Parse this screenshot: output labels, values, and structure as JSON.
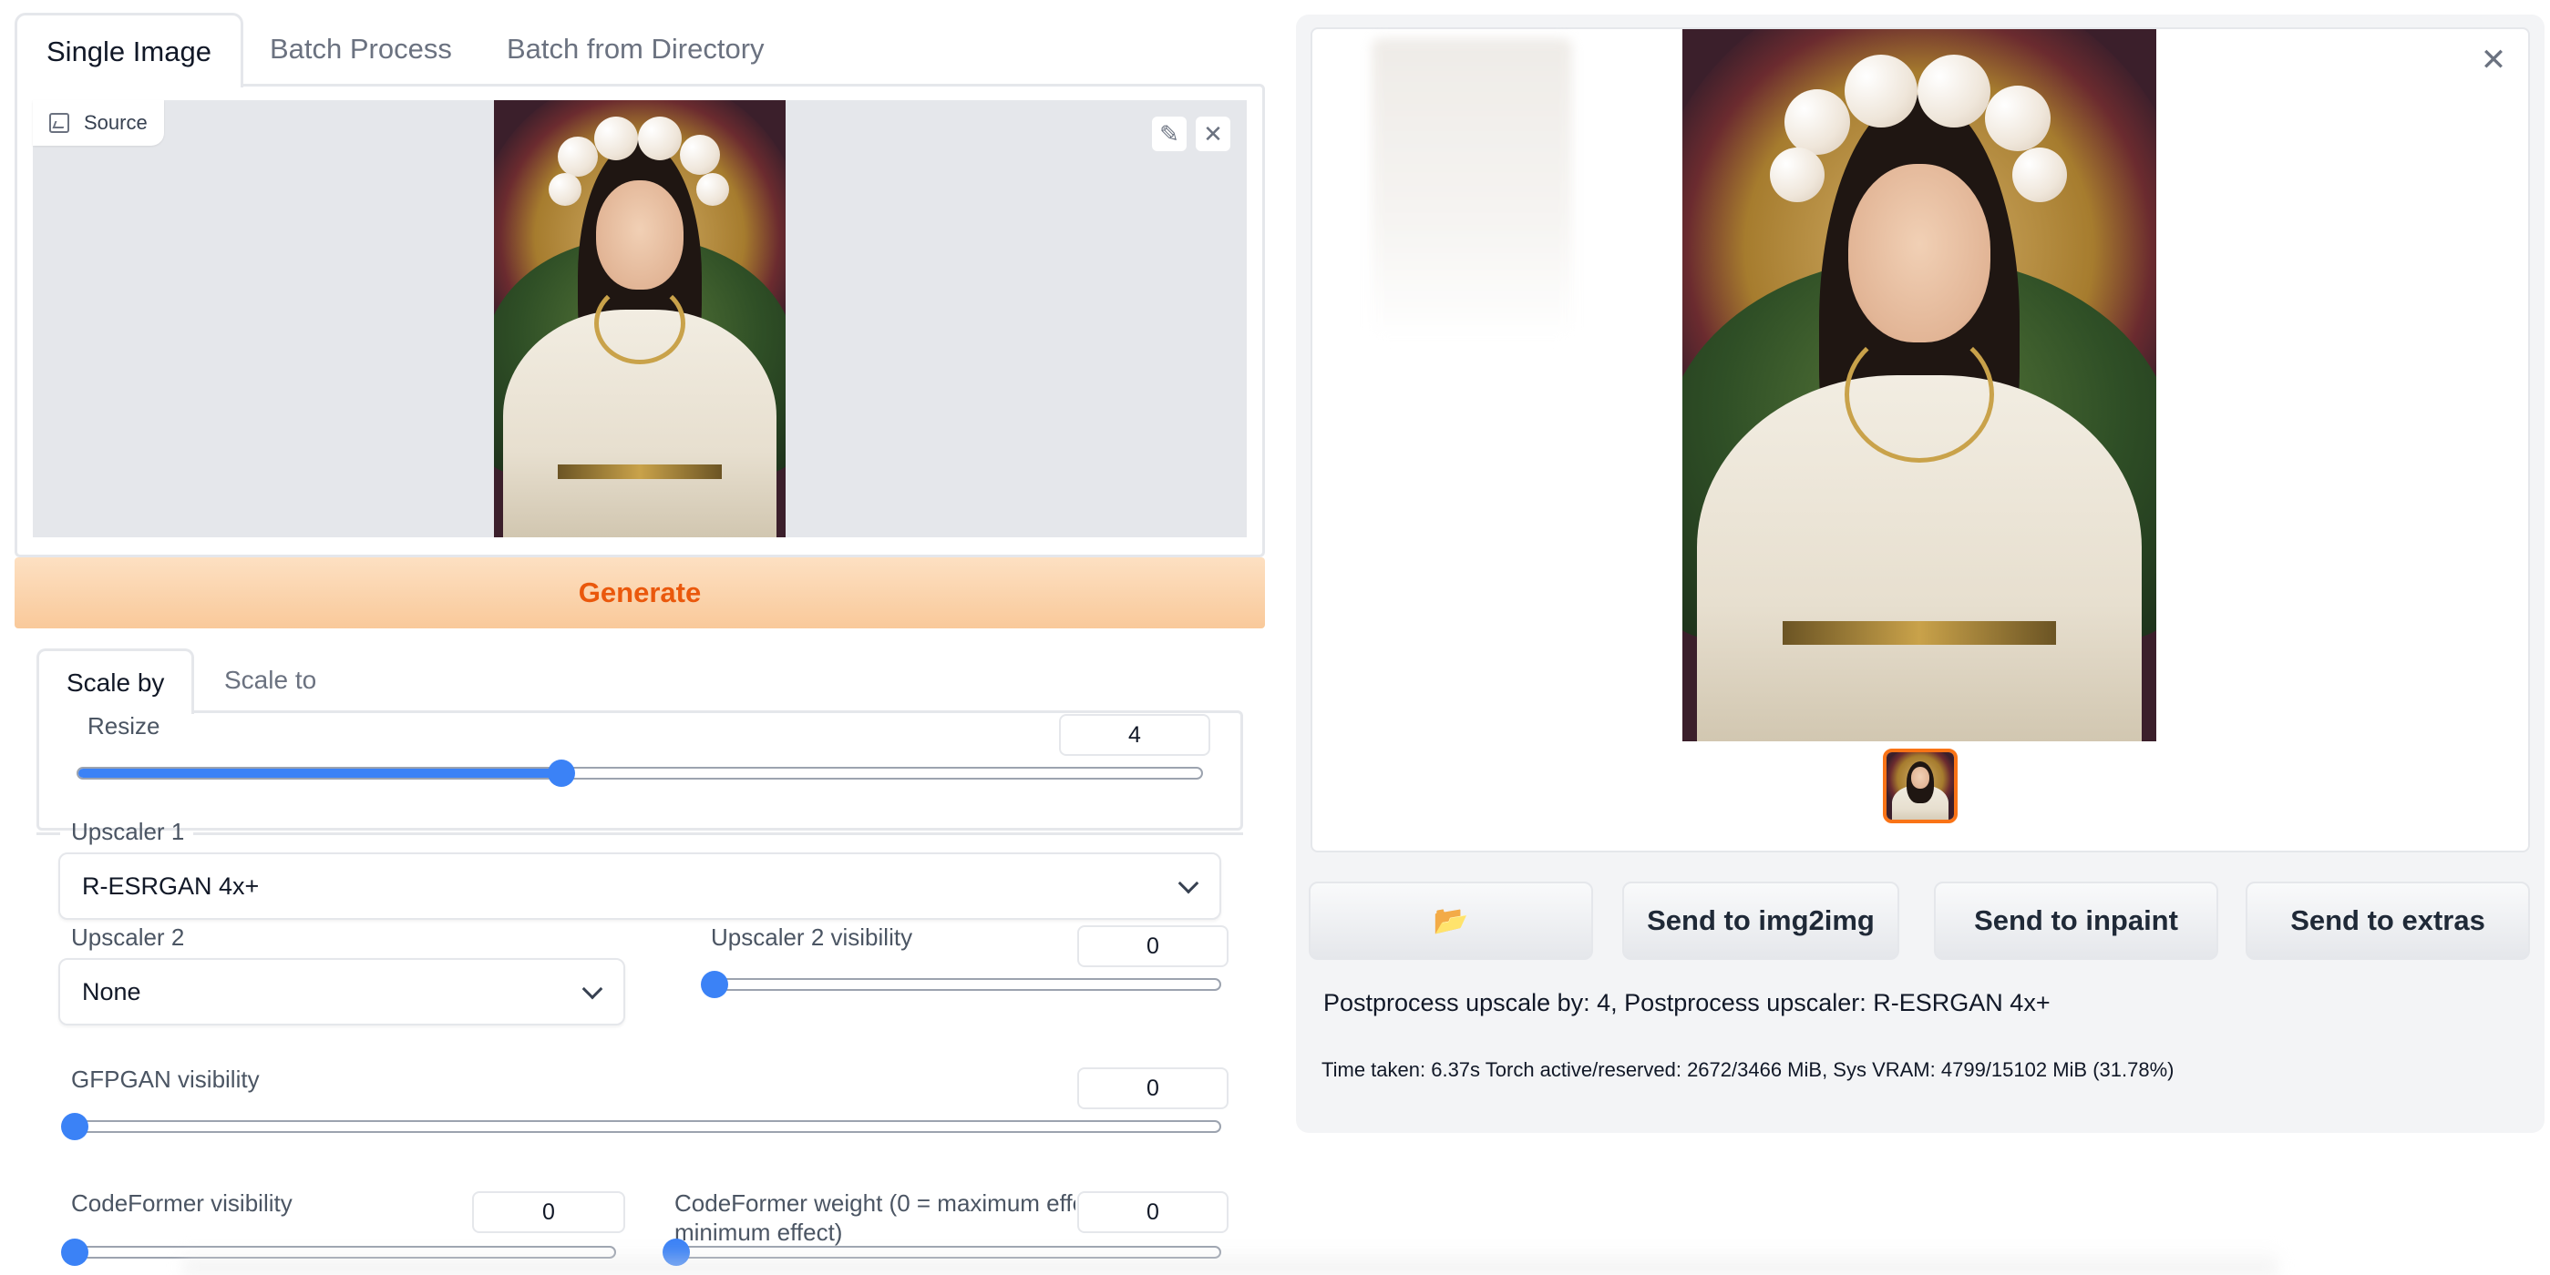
{
  "tabs": [
    {
      "label": "Single Image",
      "active": true
    },
    {
      "label": "Batch Process",
      "active": false
    },
    {
      "label": "Batch from Directory",
      "active": false
    }
  ],
  "source": {
    "label": "Source",
    "edit_icon": "pencil-icon",
    "close_icon": "close-icon"
  },
  "generate_label": "Generate",
  "scale_tabs": [
    {
      "label": "Scale by",
      "active": true
    },
    {
      "label": "Scale to",
      "active": false
    }
  ],
  "resize": {
    "label": "Resize",
    "value": "4",
    "fraction": 0.43
  },
  "upscaler1": {
    "label": "Upscaler 1",
    "value": "R-ESRGAN 4x+"
  },
  "upscaler2": {
    "label": "Upscaler 2",
    "value": "None"
  },
  "upscaler2_visibility": {
    "label": "Upscaler 2 visibility",
    "value": "0",
    "fraction": 0
  },
  "gfpgan_visibility": {
    "label": "GFPGAN visibility",
    "value": "0",
    "fraction": 0
  },
  "codeformer_visibility": {
    "label": "CodeFormer visibility",
    "value": "0",
    "fraction": 0
  },
  "codeformer_weight": {
    "label_line1": "CodeFormer weight (0 = maximum effe",
    "label_line2": "minimum effect)",
    "value": "0",
    "fraction": 0
  },
  "output": {
    "close_icon": "close-icon",
    "buttons": {
      "folder": "📂",
      "send_img2img": "Send to img2img",
      "send_inpaint": "Send to inpaint",
      "send_extras": "Send to extras"
    },
    "info_line": "Postprocess upscale by: 4, Postprocess upscaler: R-ESRGAN 4x+",
    "time_line": "Time taken: 6.37s  Torch active/reserved: 2672/3466 MiB, Sys VRAM: 4799/15102 MiB (31.78%)"
  },
  "colors": {
    "accent": "#ea580c",
    "slider": "#3b82f6",
    "generate_bg": "#f9c99a"
  }
}
